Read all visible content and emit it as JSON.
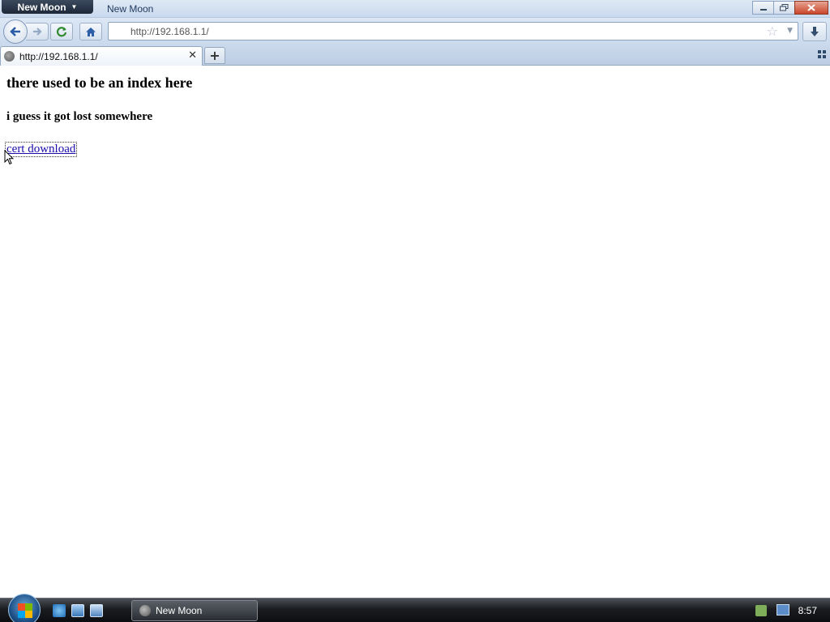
{
  "app": {
    "menu_label": "New Moon",
    "window_title": "New Moon"
  },
  "toolbar": {
    "url": "http://192.168.1.1/"
  },
  "tabs": [
    {
      "label": "http://192.168.1.1/"
    }
  ],
  "page": {
    "heading": "there used to be an index here",
    "subheading": "i guess it got lost somewhere",
    "link_text": "cert download"
  },
  "taskbar": {
    "task_label": "New Moon",
    "clock": "8:57"
  },
  "colors": {
    "link": "#1a0dab",
    "title_bar": "#dfe9f5",
    "taskbar": "#1a1c20"
  }
}
